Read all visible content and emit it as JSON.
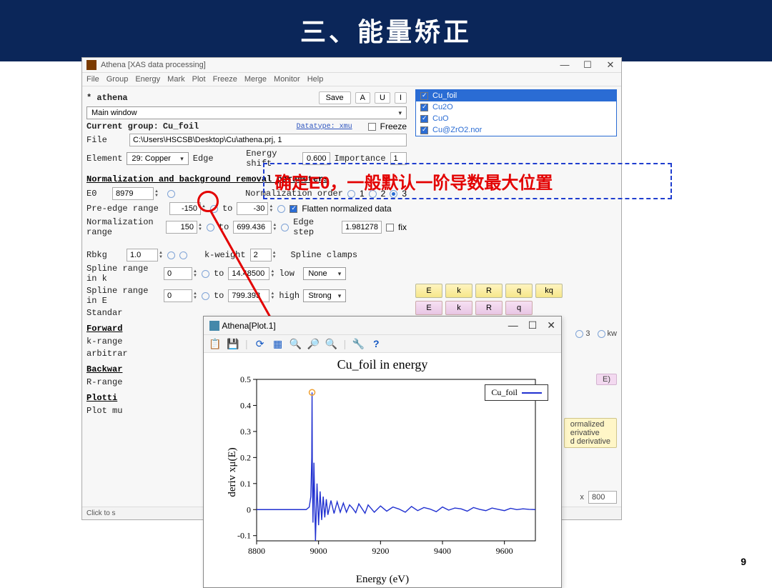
{
  "slide": {
    "title": "三、能量矫正",
    "page": "9"
  },
  "app": {
    "title": "Athena [XAS data processing]",
    "menus": [
      "File",
      "Group",
      "Energy",
      "Mark",
      "Plot",
      "Freeze",
      "Merge",
      "Monitor",
      "Help"
    ],
    "project_label": "* athena",
    "save": "Save",
    "btn_A": "A",
    "btn_U": "U",
    "btn_I": "I",
    "main_window": "Main window",
    "current_group_label": "Current group:",
    "current_group": "Cu_foil",
    "datatype_label": "Datatype:  xmu",
    "freeze": "Freeze",
    "file_label": "File",
    "file_path": "C:\\Users\\HSCSB\\Desktop\\Cu\\athena.prj, 1",
    "element_label": "Element",
    "element_value": "29: Copper",
    "edge_label": "Edge",
    "energy_shift_label": "Energy shift",
    "energy_shift_value": "0.600",
    "importance_label": "Importance",
    "importance_value": "1",
    "section_norm": "Normalization and background removal parameters",
    "e0_label": "E0",
    "e0_value": "8979",
    "norm_order_label": "Normalization order",
    "preedge_label": "Pre-edge range",
    "preedge_lo": "-150",
    "to": "to",
    "preedge_hi": "-30",
    "flatten": "Flatten normalized data",
    "norm_range_label": "Normalization range",
    "norm_lo": "150",
    "norm_hi": "699.436",
    "edge_step_label": "Edge step",
    "edge_step_value": "1.981278",
    "fix": "fix",
    "rbkg_label": "Rbkg",
    "rbkg_value": "1.0",
    "kweight_label": "k-weight",
    "kweight_value": "2",
    "spline_clamps": "Spline clamps",
    "spline_k_label": "Spline range in k",
    "spline_k_lo": "0",
    "spline_k_hi": "14.48500",
    "clamp_low_label": "low",
    "clamp_low": "None",
    "spline_e_label": "Spline range in E",
    "spline_e_lo": "0",
    "spline_e_hi": "799.393",
    "clamp_high_label": "high",
    "clamp_high": "Strong",
    "standard_label": "Standar",
    "forward_label": "Forward",
    "k_range_label": "k-range",
    "arbitrary_label": "arbitrar",
    "backward_label": "Backwar",
    "r_range_label": "R-range",
    "plotting_label": "Plotti",
    "plotmu_label": "Plot mu",
    "status": "Click to s",
    "groups": [
      "Cu_foil",
      "Cu2O",
      "CuO",
      "Cu@ZrO2.nor"
    ],
    "plot_btns_row1": [
      "E",
      "k",
      "R",
      "q",
      "kq"
    ],
    "plot_btns_row2": [
      "E",
      "k",
      "R",
      "q"
    ],
    "cut_3": "3",
    "cut_kw": "kw",
    "cut_E": "E)",
    "cut_lines": [
      "ormalized",
      "erivative",
      "d derivative"
    ],
    "cut_x": "x",
    "cut_800": "800"
  },
  "plotwin": {
    "title": "Athena[Plot.1]",
    "chart_title": "Cu_foil in energy",
    "xlabel": "Energy  (eV)",
    "ylabel": "deriv xμ(E)",
    "legend": "Cu_foil"
  },
  "annotation": {
    "text": "确定E0，一般默认一阶导数最大位置"
  },
  "chart_data": {
    "type": "line",
    "title": "Cu_foil in energy",
    "xlabel": "Energy (eV)",
    "ylabel": "deriv xμ(E)",
    "xlim": [
      8800,
      9700
    ],
    "ylim": [
      -0.12,
      0.5
    ],
    "xticks": [
      8800,
      9000,
      9200,
      9400,
      9600
    ],
    "yticks": [
      -0.1,
      0,
      0.1,
      0.2,
      0.3,
      0.4,
      0.5
    ],
    "series": [
      {
        "name": "Cu_foil",
        "x": [
          8800,
          8850,
          8900,
          8960,
          8970,
          8975,
          8978,
          8979,
          8980,
          8982,
          8985,
          8990,
          8995,
          9000,
          9005,
          9010,
          9015,
          9020,
          9025,
          9030,
          9040,
          9050,
          9060,
          9070,
          9080,
          9090,
          9100,
          9110,
          9120,
          9130,
          9140,
          9150,
          9160,
          9180,
          9200,
          9220,
          9240,
          9260,
          9280,
          9300,
          9320,
          9340,
          9360,
          9380,
          9400,
          9420,
          9440,
          9460,
          9480,
          9500,
          9520,
          9540,
          9560,
          9580,
          9600,
          9620,
          9640,
          9660,
          9680,
          9700
        ],
        "y": [
          0,
          0,
          0,
          0,
          0.01,
          0.05,
          0.2,
          0.45,
          0.12,
          -0.05,
          0.18,
          -0.12,
          0.1,
          -0.06,
          0.07,
          -0.04,
          0.05,
          -0.03,
          0.04,
          -0.02,
          0.035,
          -0.015,
          0.03,
          -0.01,
          0.025,
          -0.01,
          0.018,
          0.005,
          -0.012,
          0.022,
          0.004,
          -0.014,
          0.018,
          -0.01,
          0.014,
          -0.006,
          0.01,
          0.002,
          -0.01,
          0.012,
          -0.004,
          0.008,
          0.002,
          -0.008,
          0.01,
          -0.002,
          0.006,
          0.003,
          -0.006,
          0.008,
          0.001,
          -0.004,
          0.006,
          0.001,
          -0.004,
          0.005,
          0.0,
          0.003,
          0.001,
          0.0
        ]
      }
    ],
    "marker": {
      "x": 8979,
      "y": 0.45,
      "color": "#f0a030"
    }
  }
}
